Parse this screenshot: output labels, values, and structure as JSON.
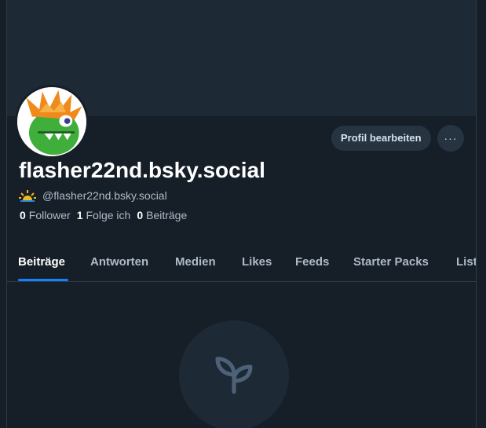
{
  "profile": {
    "display_name": "flasher22nd.bsky.social",
    "handle": "@flasher22nd.bsky.social",
    "handle_icon": "sun-icon",
    "stats": {
      "followers_count": "0",
      "followers_label": "Follower",
      "following_count": "1",
      "following_label": "Folge ich",
      "posts_count": "0",
      "posts_label": "Beiträge"
    }
  },
  "actions": {
    "edit_profile_label": "Profil bearbeiten",
    "more_label": "···",
    "more_icon": "more-horizontal-icon"
  },
  "tabs": [
    {
      "label": "Beiträge",
      "active": true
    },
    {
      "label": "Antworten",
      "active": false
    },
    {
      "label": "Medien",
      "active": false
    },
    {
      "label": "Likes",
      "active": false
    },
    {
      "label": "Feeds",
      "active": false
    },
    {
      "label": "Starter Packs",
      "active": false
    },
    {
      "label": "Listen",
      "active": false
    }
  ],
  "empty_state": {
    "icon": "sprout-icon"
  },
  "colors": {
    "background": "#161e27",
    "banner": "#1e2936",
    "accent": "#1083fe",
    "button": "#263340"
  }
}
